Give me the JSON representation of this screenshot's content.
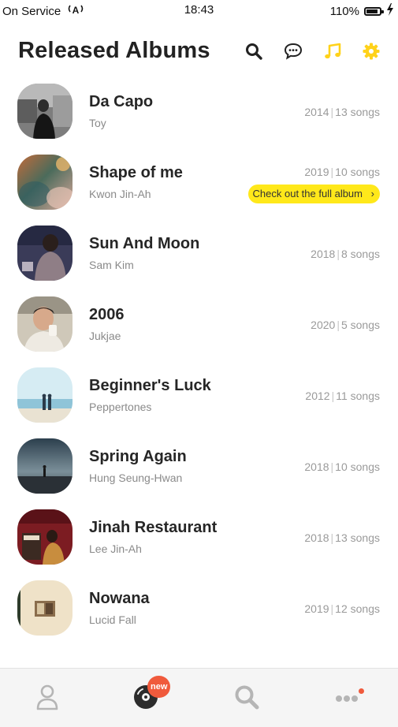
{
  "status_bar": {
    "carrier": "On Service",
    "time": "18:43",
    "battery": "110%"
  },
  "header": {
    "title": "Released Albums"
  },
  "colors": {
    "accent_yellow": "#ffd21a",
    "badge_red": "#f05a3c"
  },
  "albums": [
    {
      "title": "Da Capo",
      "artist": "Toy",
      "year": "2014",
      "songs": "13 songs"
    },
    {
      "title": "Shape of me",
      "artist": "Kwon Jin-Ah",
      "year": "2019",
      "songs": "10 songs",
      "action": "Check out the full album"
    },
    {
      "title": "Sun And Moon",
      "artist": "Sam Kim",
      "year": "2018",
      "songs": "8 songs"
    },
    {
      "title": "2006",
      "artist": "Jukjae",
      "year": "2020",
      "songs": "5 songs"
    },
    {
      "title": "Beginner's Luck",
      "artist": "Peppertones",
      "year": "2012",
      "songs": "11 songs"
    },
    {
      "title": "Spring Again",
      "artist": "Hung Seung-Hwan",
      "year": "2018",
      "songs": "10 songs"
    },
    {
      "title": "Jinah Restaurant",
      "artist": "Lee Jin-Ah",
      "year": "2018",
      "songs": "13 songs"
    },
    {
      "title": "Nowana",
      "artist": "Lucid Fall",
      "year": "2019",
      "songs": "12 songs"
    }
  ],
  "tab_bar": {
    "new_badge": "new",
    "tabs": [
      "profile-icon",
      "album-disc-icon",
      "search-icon",
      "more-icon"
    ]
  }
}
